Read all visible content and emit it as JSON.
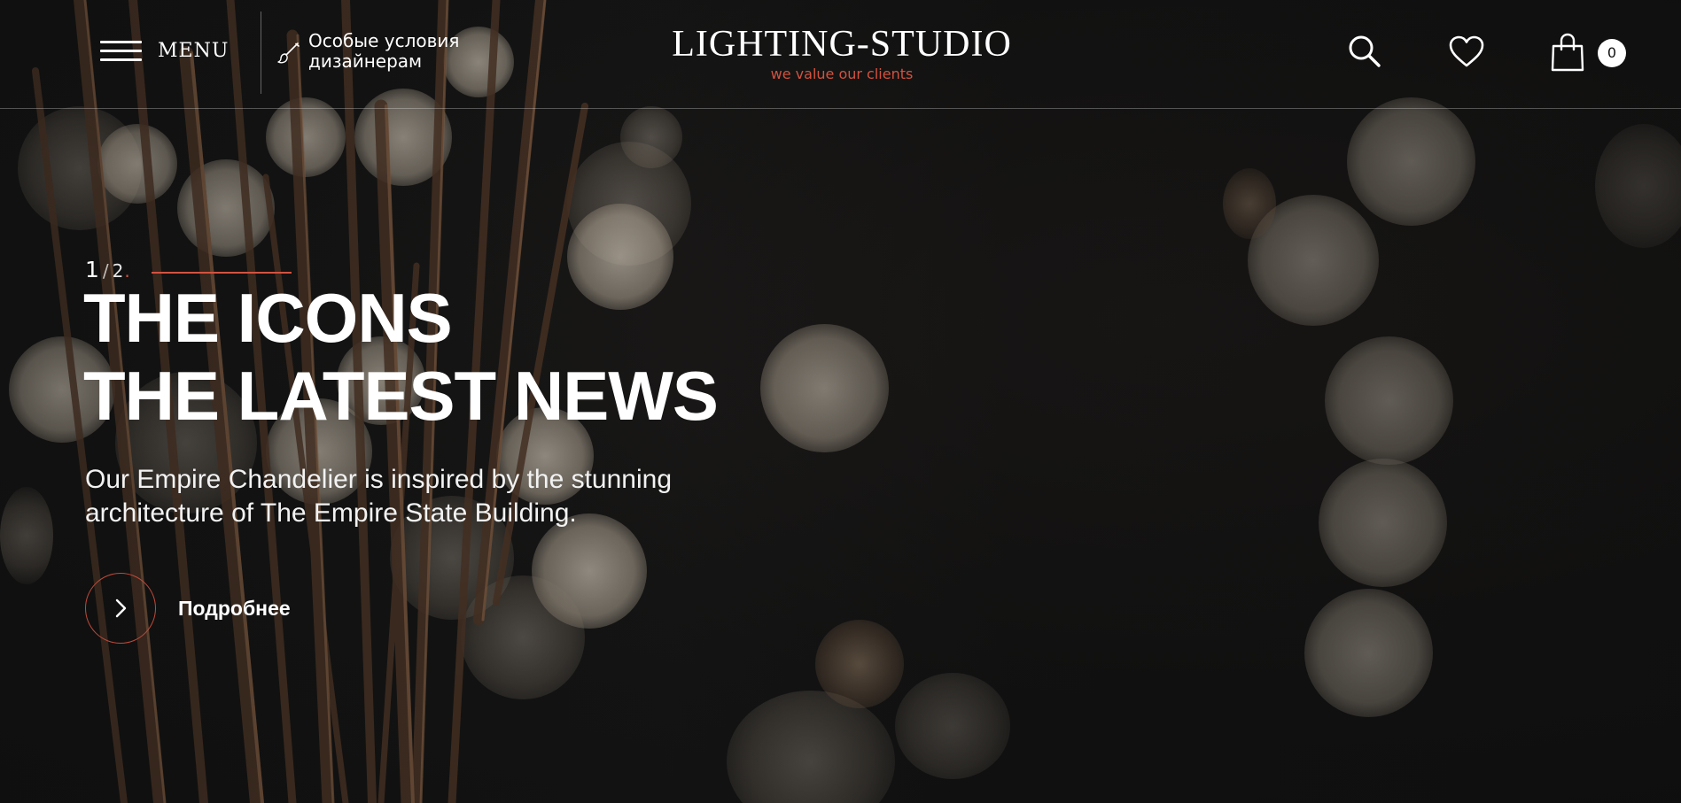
{
  "header": {
    "menu_label": "MENU",
    "designers_text": "Особые условия дизайнерам",
    "logo_title": "LIGHTING-STUDIO",
    "logo_tagline": "we value our clients",
    "cart_count": "0",
    "icons": {
      "menu": "hamburger-icon",
      "designers": "brush-icon",
      "search": "search-icon",
      "favorites": "heart-icon",
      "cart": "shopping-bag-icon"
    }
  },
  "slider": {
    "current": "1",
    "separator": "/",
    "total": "2",
    "dot": "."
  },
  "hero": {
    "title_line1": "THE ICONS",
    "title_line2": "THE LATEST NEWS",
    "description": "Our Empire Chandelier is inspired by the stunning architecture of The Empire State Building.",
    "more_label": "Подробнее",
    "more_icon": "chevron-right-icon"
  },
  "colors": {
    "accent": "#d2523f",
    "background": "#151515",
    "text": "#ffffff"
  }
}
